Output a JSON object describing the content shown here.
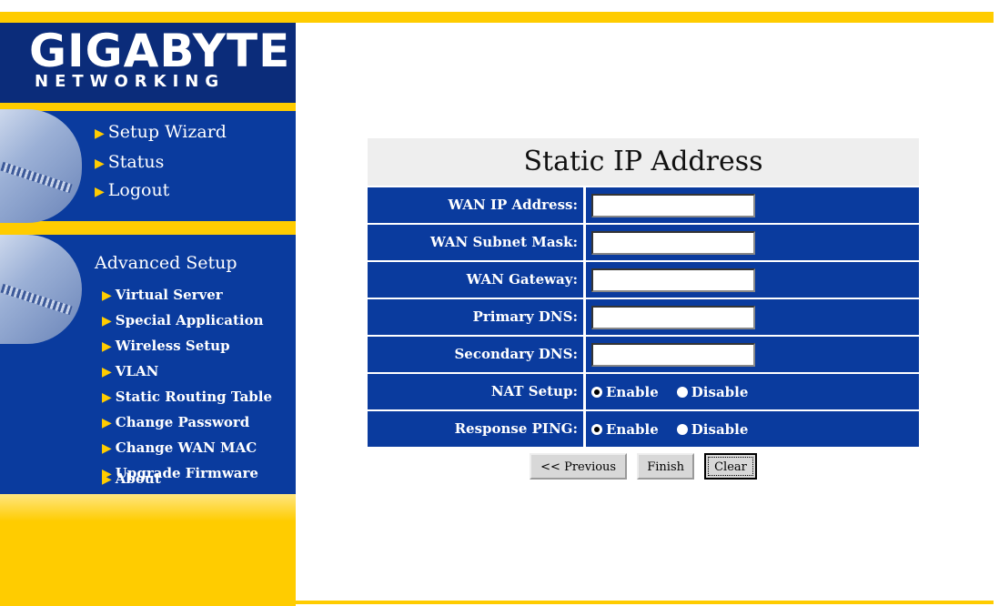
{
  "logo": {
    "main": "GIGABYTE",
    "sub": "NETWORKING"
  },
  "nav": [
    {
      "label": "Setup Wizard"
    },
    {
      "label": "Status"
    },
    {
      "label": "Logout"
    }
  ],
  "advanced": {
    "title": "Advanced Setup",
    "items": [
      {
        "label": "Virtual Server"
      },
      {
        "label": "Special Application"
      },
      {
        "label": "Wireless Setup"
      },
      {
        "label": "VLAN"
      },
      {
        "label": "Static Routing Table"
      },
      {
        "label": "Change Password"
      },
      {
        "label": "Change WAN MAC"
      },
      {
        "label": "Upgrade Firmware"
      },
      {
        "label": "About"
      }
    ]
  },
  "form": {
    "title": "Static IP Address",
    "fields": [
      {
        "label": "WAN IP Address:",
        "value": ""
      },
      {
        "label": "WAN Subnet Mask:",
        "value": ""
      },
      {
        "label": "WAN Gateway:",
        "value": ""
      },
      {
        "label": "Primary DNS:",
        "value": ""
      },
      {
        "label": "Secondary DNS:",
        "value": ""
      }
    ],
    "nat": {
      "label": "NAT Setup:",
      "enable": "Enable",
      "disable": "Disable",
      "selected": "Enable"
    },
    "ping": {
      "label": "Response PING:",
      "enable": "Enable",
      "disable": "Disable",
      "selected": "Enable"
    }
  },
  "buttons": {
    "previous": "<< Previous",
    "finish": "Finish",
    "clear": "Clear"
  },
  "colors": {
    "navy": "#0a3b9e",
    "logo_bg": "#0b2c7a",
    "accent": "#ffcc00"
  }
}
